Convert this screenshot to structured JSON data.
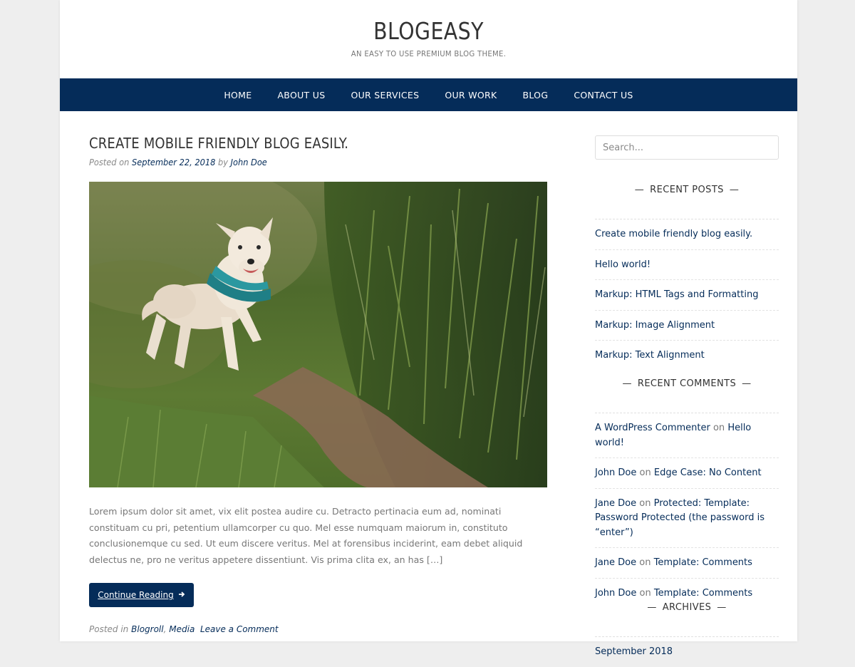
{
  "site": {
    "title": "BLOGEASY",
    "tagline": "AN EASY TO USE PREMIUM BLOG THEME."
  },
  "nav": [
    "HOME",
    "ABOUT US",
    "OUR SERVICES",
    "OUR WORK",
    "BLOG",
    "CONTACT US"
  ],
  "post": {
    "title": "CREATE MOBILE FRIENDLY BLOG EASILY.",
    "meta_prefix": "Posted on",
    "date": "September 22, 2018",
    "meta_by": "by",
    "author": "John Doe",
    "excerpt": "Lorem ipsum dolor sit amet, vix elit postea audire cu. Detracto pertinacia eum ad, nominati constituam cu pri, petentium ullamcorper cu quo. Mel esse numquam maiorum in, constituto conclusionemque cu sed. Ut eum discere veritus. Mel at forensibus inciderint, eam debet aliquid delectus ne, pro ne veritus appetere dissentiunt. Vis prima clita ex, an has […]",
    "read_more": "Continue Reading",
    "footer_prefix": "Posted in",
    "category_1": "Blogroll",
    "category_sep": ",",
    "category_2": "Media",
    "comment_link": "Leave a Comment"
  },
  "sidebar": {
    "search_placeholder": "Search...",
    "recent_posts_title": "RECENT POSTS",
    "recent_posts": [
      "Create mobile friendly blog easily.",
      "Hello world!",
      "Markup: HTML Tags and Formatting",
      "Markup: Image Alignment",
      "Markup: Text Alignment"
    ],
    "recent_comments_title": "RECENT COMMENTS",
    "recent_comments": [
      {
        "author": "A WordPress Commenter",
        "on": "on",
        "post": "Hello world!"
      },
      {
        "author": "John Doe",
        "on": "on",
        "post": "Edge Case: No Content"
      },
      {
        "author": "Jane Doe",
        "on": "on",
        "post": "Protected: Template: Password Protected (the password is “enter”)"
      },
      {
        "author": "Jane Doe",
        "on": "on",
        "post": "Template: Comments"
      },
      {
        "author": "John Doe",
        "on": "on",
        "post": "Template: Comments"
      }
    ],
    "archives_title": "ARCHIVES",
    "archives": [
      "September 2018"
    ]
  },
  "colors": {
    "nav_bg": "#052c59",
    "link": "#052c59",
    "page_bg": "#eeeeee"
  }
}
